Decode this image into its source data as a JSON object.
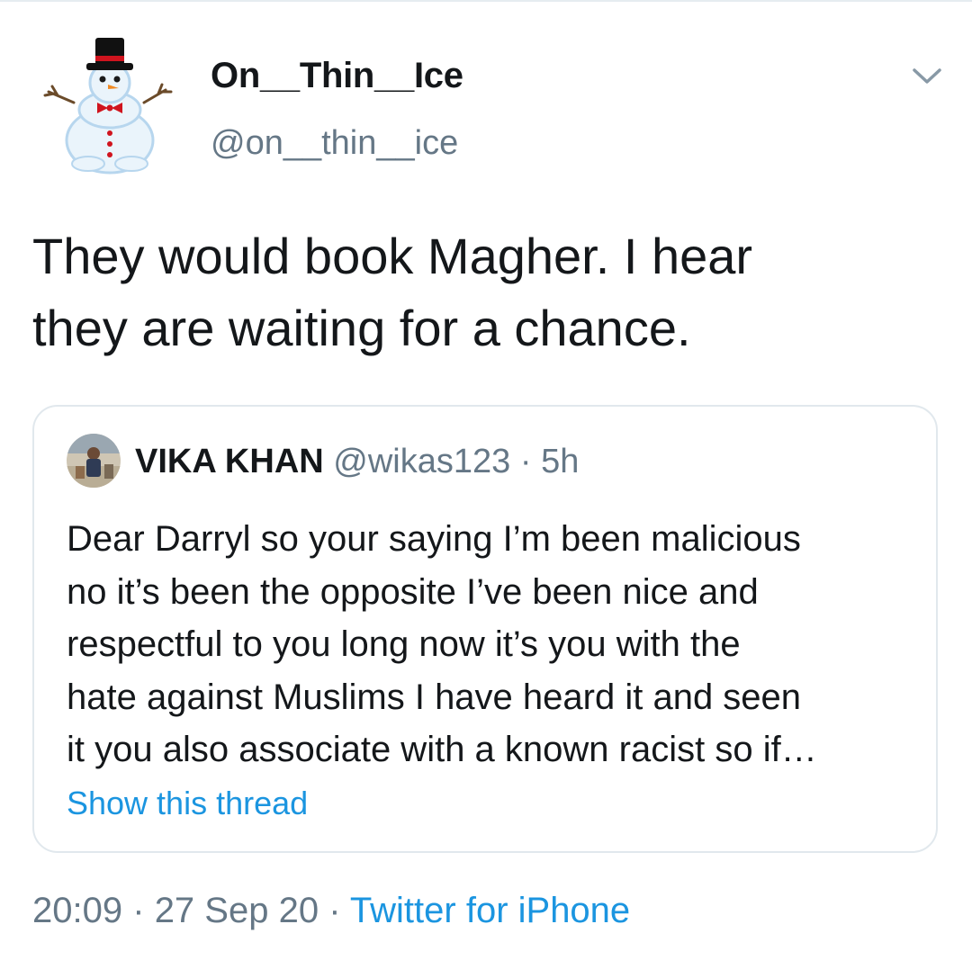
{
  "tweet": {
    "display_name": "On__Thin__Ice",
    "handle": "@on__thin__ice",
    "text_line1": "They would book Magher. I hear",
    "text_line2": "they are waiting for a chance.",
    "avatar_icon": "snowman-avatar-icon",
    "menu_icon": "chevron-down-icon",
    "time": "20:09",
    "separator": "·",
    "date": "27 Sep 20",
    "source": "Twitter for iPhone"
  },
  "quote": {
    "display_name": "VIKA KHAN",
    "handle": "@wikas123",
    "separator": "·",
    "time": "5h",
    "lines": [
      "Dear Darryl so your saying I’m been malicious",
      "no it’s been the opposite I’ve been nice and",
      "respectful to you long now it’s you with the",
      "hate against Muslims I have heard it and seen",
      "it you also associate with a known racist so if…"
    ],
    "show_thread": "Show this thread"
  },
  "colors": {
    "text_primary": "#14171a",
    "text_secondary": "#657786",
    "link": "#1b95e0",
    "border": "#e1e8ed"
  }
}
